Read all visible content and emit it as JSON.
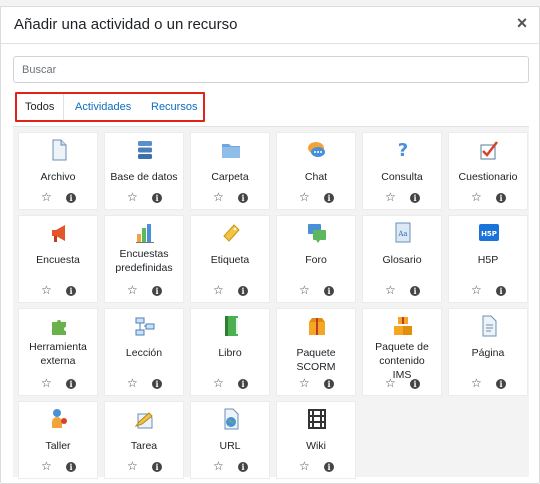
{
  "modal": {
    "title": "Añadir una actividad o un recurso",
    "close_symbol": "×"
  },
  "search": {
    "placeholder": "Buscar",
    "value": ""
  },
  "tabs": [
    {
      "label": "Todos",
      "active": true
    },
    {
      "label": "Actividades",
      "active": false
    },
    {
      "label": "Recursos",
      "active": false
    }
  ],
  "highlight_color": "#e2231a",
  "link_color": "#0f6cbf",
  "modules": [
    {
      "label": "Archivo",
      "icon": "file-icon"
    },
    {
      "label": "Base de datos",
      "icon": "database-icon"
    },
    {
      "label": "Carpeta",
      "icon": "folder-icon"
    },
    {
      "label": "Chat",
      "icon": "chat-icon"
    },
    {
      "label": "Consulta",
      "icon": "question-icon"
    },
    {
      "label": "Cuestionario",
      "icon": "quiz-icon"
    },
    {
      "label": "Encuesta",
      "icon": "megaphone-icon"
    },
    {
      "label": "Encuestas predefinidas",
      "icon": "bar-chart-icon"
    },
    {
      "label": "Etiqueta",
      "icon": "label-tag-icon"
    },
    {
      "label": "Foro",
      "icon": "forum-icon"
    },
    {
      "label": "Glosario",
      "icon": "glossary-icon"
    },
    {
      "label": "H5P",
      "icon": "h5p-icon"
    },
    {
      "label": "Herramienta externa",
      "icon": "puzzle-icon"
    },
    {
      "label": "Lección",
      "icon": "lesson-icon"
    },
    {
      "label": "Libro",
      "icon": "book-icon"
    },
    {
      "label": "Paquete SCORM",
      "icon": "scorm-package-icon"
    },
    {
      "label": "Paquete de contenido IMS",
      "icon": "ims-package-icon"
    },
    {
      "label": "Página",
      "icon": "page-icon"
    },
    {
      "label": "Taller",
      "icon": "workshop-icon"
    },
    {
      "label": "Tarea",
      "icon": "assignment-icon"
    },
    {
      "label": "URL",
      "icon": "url-icon"
    },
    {
      "label": "Wiki",
      "icon": "wiki-icon"
    }
  ],
  "star_symbol": "☆",
  "info_symbol": "i"
}
